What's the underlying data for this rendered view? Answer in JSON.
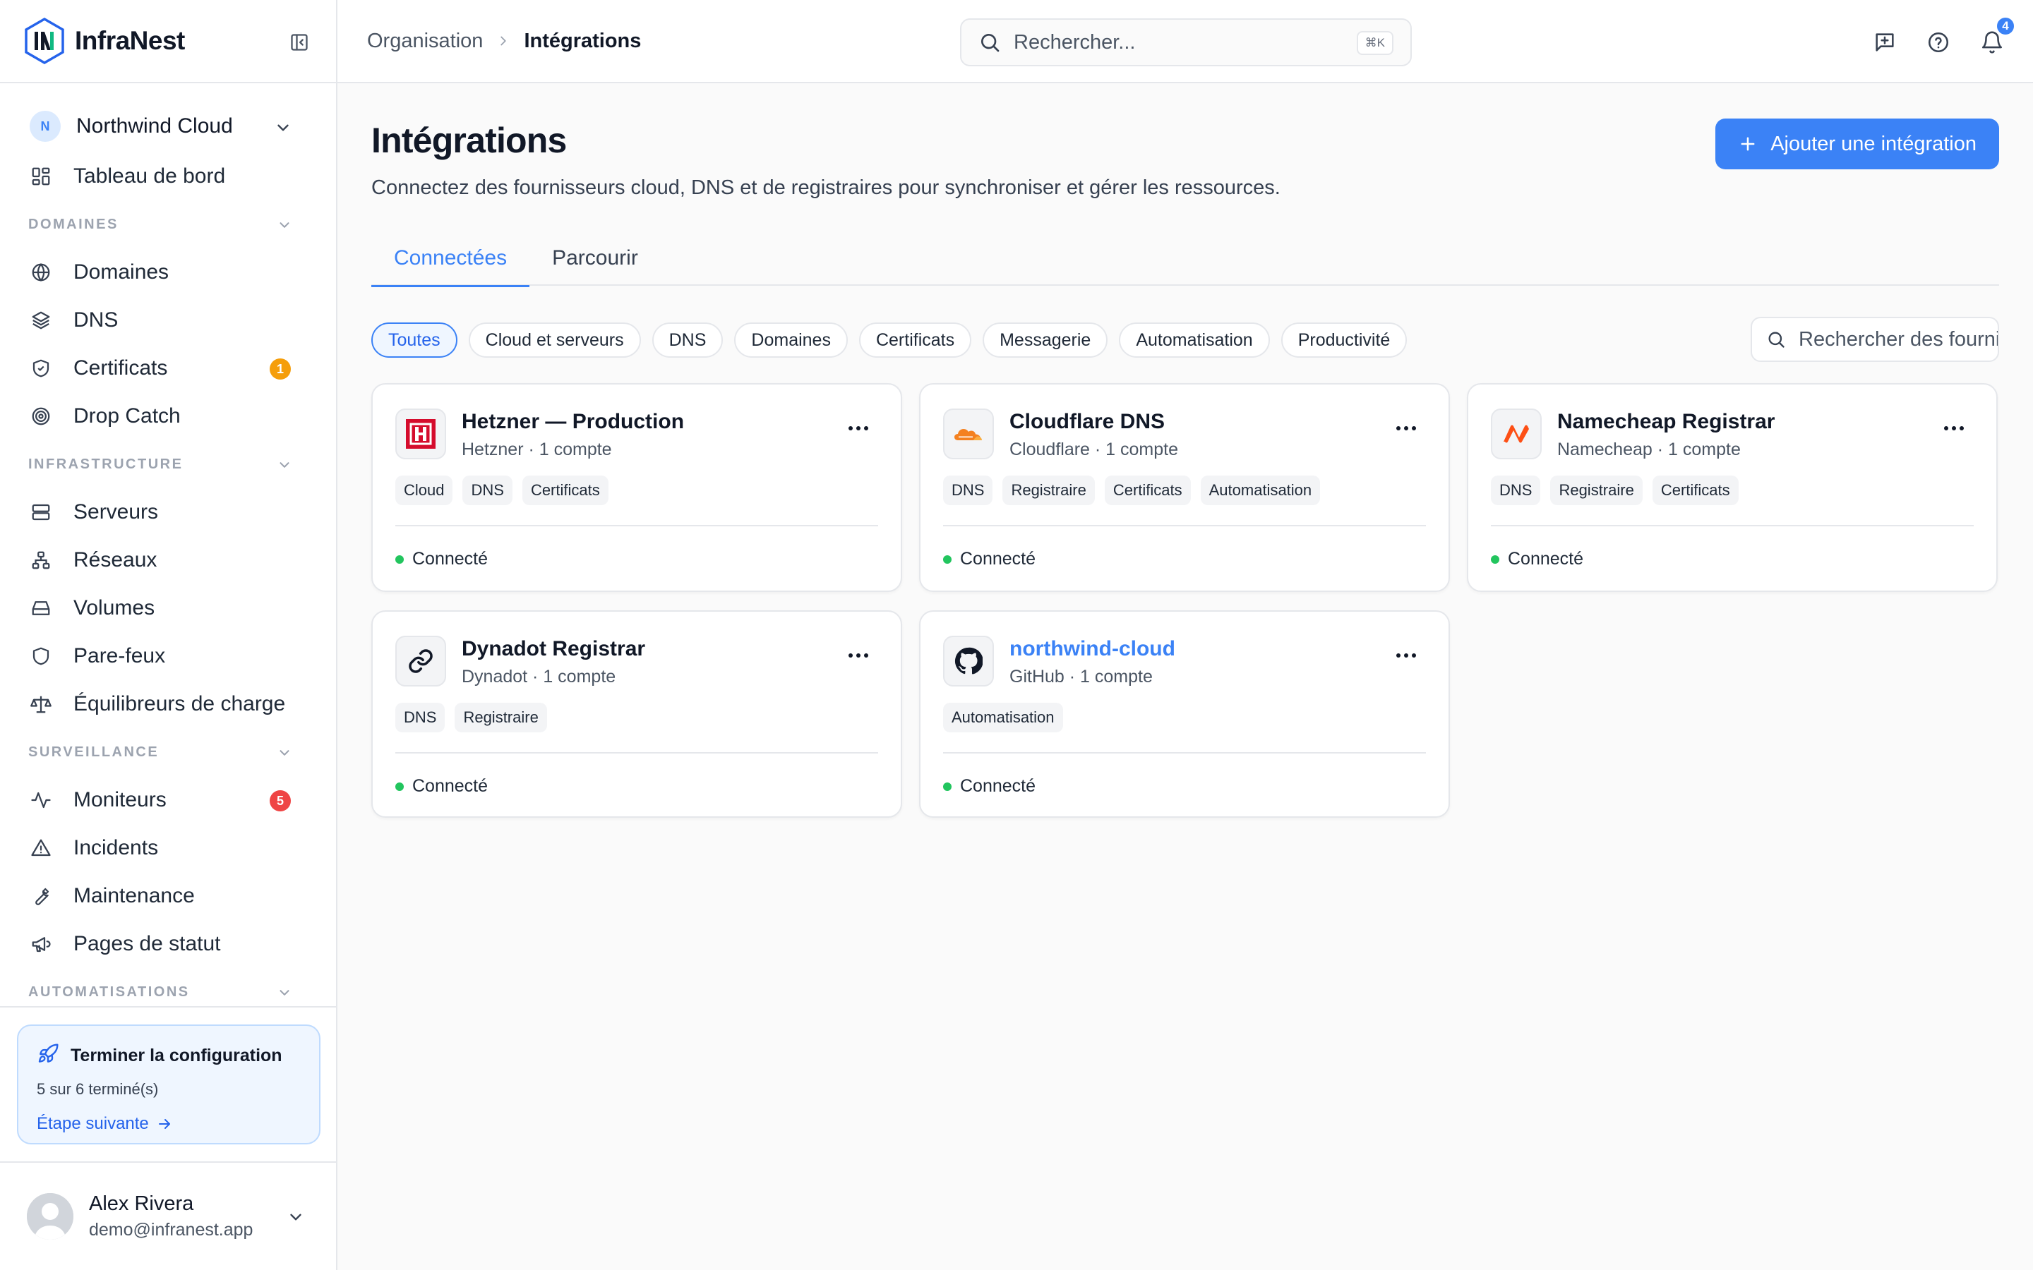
{
  "brand": {
    "name": "InfraNest"
  },
  "org": {
    "initial": "N",
    "name": "Northwind Cloud"
  },
  "sidebar": {
    "dashboard": "Tableau de bord",
    "sections": {
      "domains": {
        "title": "DOMAINES",
        "items": [
          {
            "label": "Domaines",
            "icon": "globe-icon"
          },
          {
            "label": "DNS",
            "icon": "layers-icon"
          },
          {
            "label": "Certificats",
            "icon": "shield-check-icon",
            "badge": "1",
            "badge_color": "#f59e0b"
          },
          {
            "label": "Drop Catch",
            "icon": "target-icon"
          }
        ]
      },
      "infrastructure": {
        "title": "INFRASTRUCTURE",
        "items": [
          {
            "label": "Serveurs",
            "icon": "server-icon"
          },
          {
            "label": "Réseaux",
            "icon": "network-icon"
          },
          {
            "label": "Volumes",
            "icon": "hard-drive-icon"
          },
          {
            "label": "Pare-feux",
            "icon": "shield-icon"
          },
          {
            "label": "Équilibreurs de charge",
            "icon": "scale-icon"
          }
        ]
      },
      "monitoring": {
        "title": "SURVEILLANCE",
        "items": [
          {
            "label": "Moniteurs",
            "icon": "activity-icon",
            "badge": "5",
            "badge_color": "#ef4444"
          },
          {
            "label": "Incidents",
            "icon": "alert-triangle-icon"
          },
          {
            "label": "Maintenance",
            "icon": "wrench-icon"
          },
          {
            "label": "Pages de statut",
            "icon": "megaphone-icon"
          }
        ]
      },
      "automation": {
        "title": "AUTOMATISATIONS"
      }
    }
  },
  "setup": {
    "title": "Terminer la configuration",
    "progress": "5 sur 6 terminé(s)",
    "next": "Étape suivante"
  },
  "user": {
    "name": "Alex Rivera",
    "email": "demo@infranest.app"
  },
  "topbar": {
    "breadcrumb": [
      "Organisation",
      "Intégrations"
    ],
    "search_placeholder": "Rechercher...",
    "search_shortcut": "⌘K",
    "notifications_count": "4"
  },
  "page": {
    "title": "Intégrations",
    "description": "Connectez des fournisseurs cloud, DNS et de registraires pour synchroniser et gérer les ressources.",
    "add_button": "Ajouter une intégration"
  },
  "tabs": [
    {
      "label": "Connectées",
      "active": true
    },
    {
      "label": "Parcourir",
      "active": false
    }
  ],
  "filters": {
    "chips": [
      "Toutes",
      "Cloud et serveurs",
      "DNS",
      "Domaines",
      "Certificats",
      "Messagerie",
      "Automatisation",
      "Productivité"
    ],
    "active": "Toutes",
    "search_placeholder": "Rechercher des fournisseurs"
  },
  "integrations": [
    {
      "title": "Hetzner — Production",
      "subtitle": "Hetzner · 1 compte",
      "tags": [
        "Cloud",
        "DNS",
        "Certificats"
      ],
      "status": "Connecté",
      "logo": "hetzner-logo"
    },
    {
      "title": "Cloudflare DNS",
      "subtitle": "Cloudflare · 1 compte",
      "tags": [
        "DNS",
        "Registraire",
        "Certificats",
        "Automatisation"
      ],
      "status": "Connecté",
      "logo": "cloudflare-logo"
    },
    {
      "title": "Namecheap Registrar",
      "subtitle": "Namecheap · 1 compte",
      "tags": [
        "DNS",
        "Registraire",
        "Certificats"
      ],
      "status": "Connecté",
      "logo": "namecheap-logo"
    },
    {
      "title": "Dynadot Registrar",
      "subtitle": "Dynadot · 1 compte",
      "tags": [
        "DNS",
        "Registraire"
      ],
      "status": "Connecté",
      "logo": "link-icon"
    },
    {
      "title": "northwind-cloud",
      "subtitle": "GitHub · 1 compte",
      "tags": [
        "Automatisation"
      ],
      "status": "Connecté",
      "logo": "github-logo",
      "is_link": true
    }
  ]
}
